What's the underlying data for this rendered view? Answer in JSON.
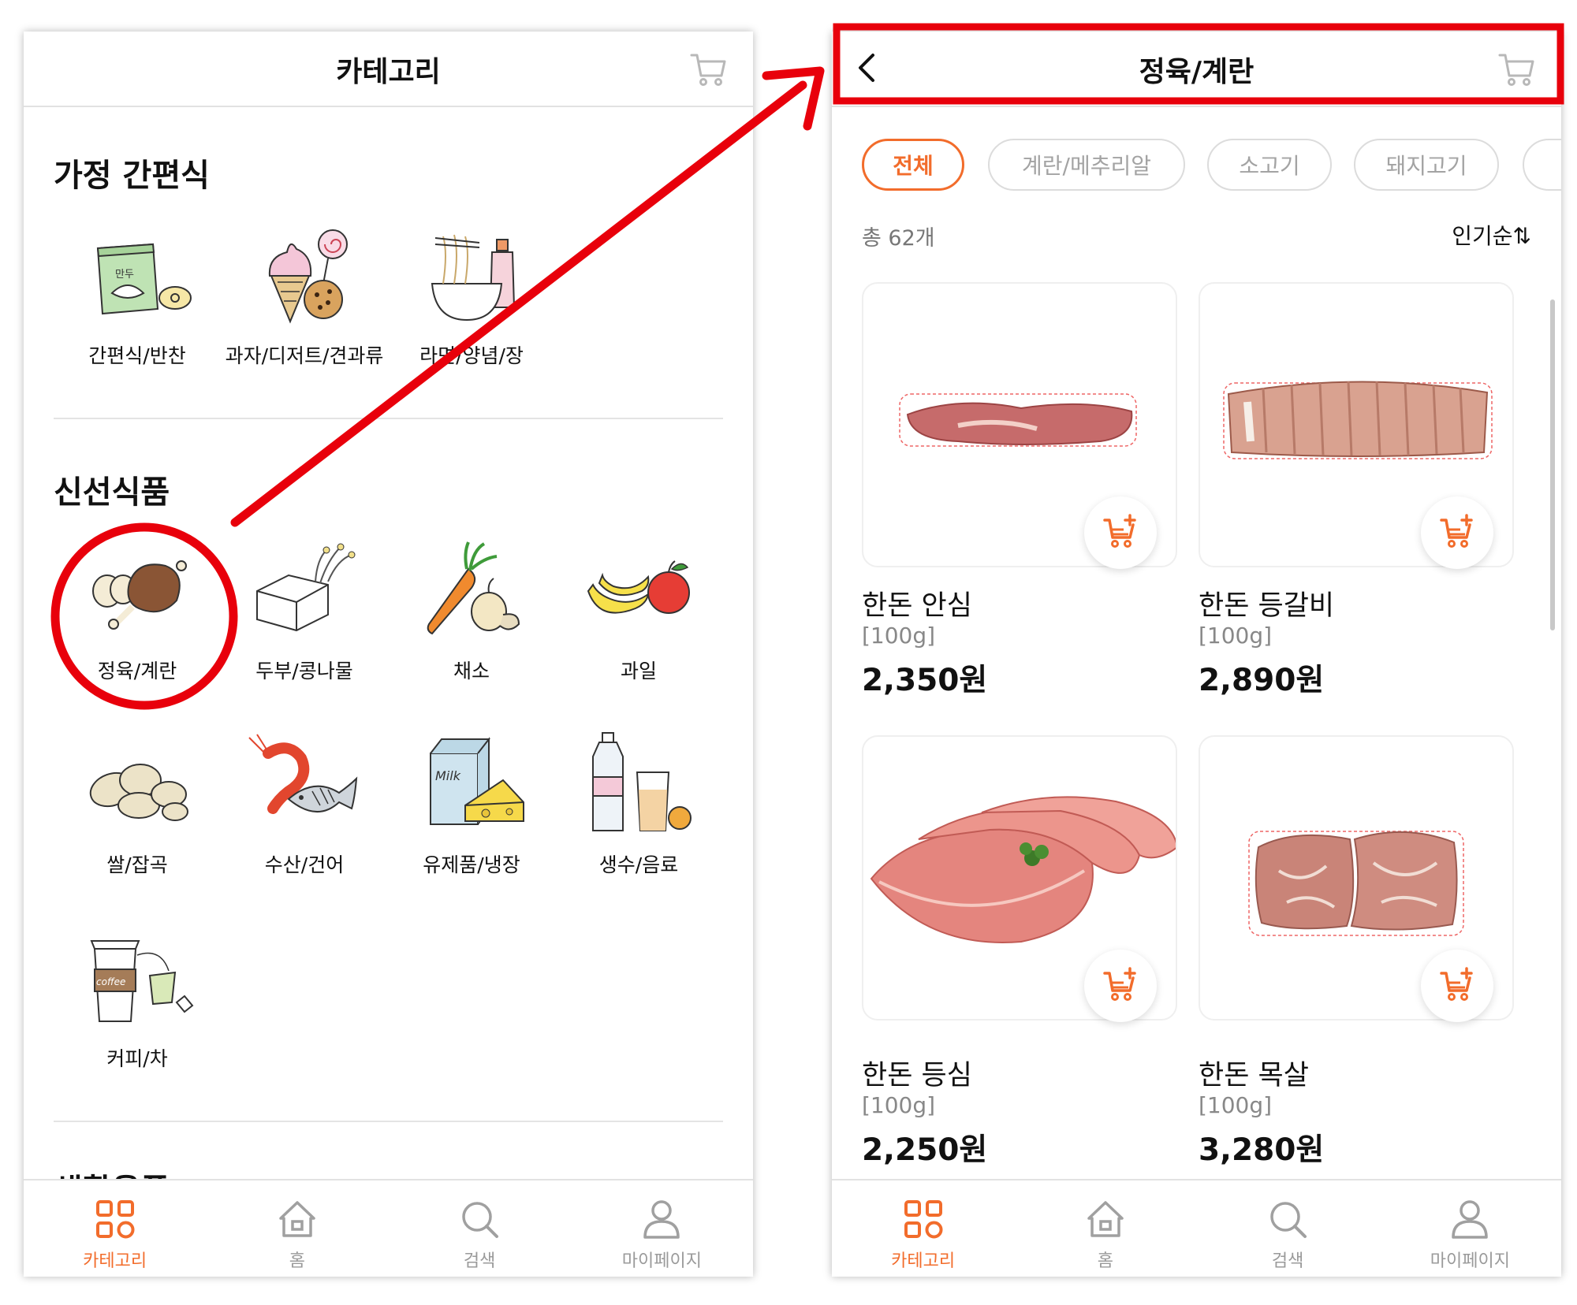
{
  "left_screen": {
    "header_title": "카테고리",
    "sections": [
      {
        "title": "가정 간편식",
        "items": [
          {
            "label": "간편식/반찬",
            "icon": "dumpling-pack-icon"
          },
          {
            "label": "과자/디저트/견과류",
            "icon": "icecream-cookie-icon"
          },
          {
            "label": "라면/양념/장",
            "icon": "noodle-bowl-icon"
          }
        ]
      },
      {
        "title": "신선식품",
        "items": [
          {
            "label": "정육/계란",
            "icon": "meat-egg-icon"
          },
          {
            "label": "두부/콩나물",
            "icon": "tofu-sprout-icon"
          },
          {
            "label": "채소",
            "icon": "carrot-onion-icon"
          },
          {
            "label": "과일",
            "icon": "banana-apple-icon"
          },
          {
            "label": "쌀/잡곡",
            "icon": "grain-icon"
          },
          {
            "label": "수산/건어",
            "icon": "shrimp-fish-icon"
          },
          {
            "label": "유제품/냉장",
            "icon": "milk-cheese-icon"
          },
          {
            "label": "생수/음료",
            "icon": "water-juice-icon"
          },
          {
            "label": "커피/차",
            "icon": "coffee-tea-icon"
          }
        ]
      },
      {
        "title": "생활용품"
      }
    ],
    "milk_text": "Milk",
    "coffee_text": "coffee",
    "dumpling_text": "만두"
  },
  "right_screen": {
    "header_title": "정육/계란",
    "chips": [
      "전체",
      "계란/메추리알",
      "소고기",
      "돼지고기"
    ],
    "total_count": "총 62개",
    "sort_label": "인기순⇅",
    "products": [
      {
        "name": "한돈 안심",
        "unit": "[100g]",
        "price": "2,350원"
      },
      {
        "name": "한돈 등갈비",
        "unit": "[100g]",
        "price": "2,890원"
      },
      {
        "name": "한돈 등심",
        "unit": "[100g]",
        "price": "2,250원"
      },
      {
        "name": "한돈 목살",
        "unit": "[100g]",
        "price": "3,280원"
      }
    ]
  },
  "bottom_nav": [
    {
      "label": "카테고리",
      "icon": "category-grid-icon",
      "active": true
    },
    {
      "label": "홈",
      "icon": "home-icon",
      "active": false
    },
    {
      "label": "검색",
      "icon": "search-icon",
      "active": false
    },
    {
      "label": "마이페이지",
      "icon": "person-icon",
      "active": false
    }
  ],
  "colors": {
    "accent": "#f26c2b",
    "annotation_red": "#e8000b",
    "divider": "#e4e4e4",
    "inactive_text": "#a3a3a3"
  }
}
